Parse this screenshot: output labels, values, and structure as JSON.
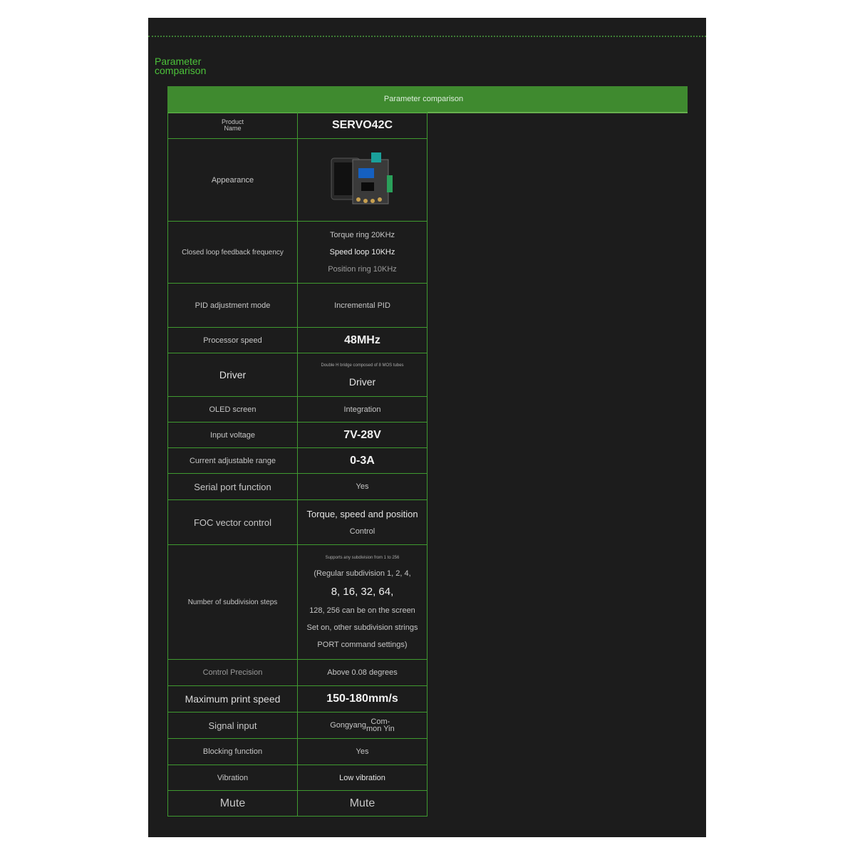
{
  "heading": [
    "Parameter",
    "comparison"
  ],
  "banner_title": "Parameter comparison",
  "colors": {
    "background": "#1c1c1c",
    "accent_green": "#3f8a2f",
    "heading_green": "#4cc23a",
    "border_green": "#3f9a30"
  },
  "table": {
    "product_label": [
      "Product",
      "Name"
    ],
    "product_value": "SERVO42C",
    "appearance_label": "Appearance",
    "closed_loop": {
      "label": "Closed loop feedback frequency",
      "values": [
        "Torque ring 20KHz",
        "Speed loop 10KHz",
        "Position ring 10KHz"
      ]
    },
    "pid": {
      "label": "PID adjustment mode",
      "value": "Incremental PID"
    },
    "processor": {
      "label": "Processor speed",
      "value": "48MHz"
    },
    "driver": {
      "label": "Driver",
      "note": "Double H bridge composed of 8 MOS tubes",
      "value": "Driver"
    },
    "oled": {
      "label": "OLED screen",
      "value": "Integration"
    },
    "voltage": {
      "label": "Input voltage",
      "value": "7V-28V"
    },
    "current": {
      "label": "Current adjustable range",
      "value": "0-3A"
    },
    "serial": {
      "label": "Serial port function",
      "value": "Yes"
    },
    "foc": {
      "label": "FOC vector control",
      "values": [
        "Torque, speed and position",
        "Control"
      ]
    },
    "subdivision": {
      "label": "Number of subdivision steps",
      "note": "Supports any subdivision from 1 to 256",
      "lines": [
        "(Regular subdivision 1, 2, 4,",
        "8, 16, 32, 64,",
        "128, 256 can be on the screen",
        "Set on, other subdivision strings",
        "PORT command settings)"
      ]
    },
    "precision": {
      "label": "Control Precision",
      "value": "Above 0.08 degrees"
    },
    "print_speed": {
      "label": "Maximum print speed",
      "value": "150-180mm/s"
    },
    "signal": {
      "label": "Signal input",
      "value_a": "Gongyang",
      "value_b": [
        "Com-",
        "mon Yin"
      ]
    },
    "blocking": {
      "label": "Blocking function",
      "value": "Yes"
    },
    "vibration": {
      "label": "Vibration",
      "value": "Low vibration"
    },
    "mute": {
      "label": "Mute",
      "value": "Mute"
    }
  }
}
